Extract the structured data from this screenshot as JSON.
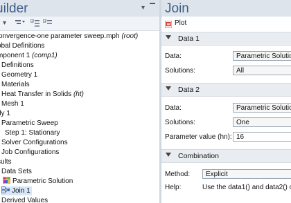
{
  "model_builder": {
    "title": "uilder",
    "tree": [
      {
        "label": "onvergence-one parameter sweep.mph",
        "tag": "(root)"
      },
      {
        "label": "obal Definitions",
        "tag": ""
      },
      {
        "label": "mponent 1",
        "tag": "(comp1)"
      },
      {
        "label": "Definitions",
        "tag": ""
      },
      {
        "label": "Geometry 1",
        "tag": ""
      },
      {
        "label": "Materials",
        "tag": ""
      },
      {
        "label": "Heat Transfer in Solids",
        "tag": "(ht)"
      },
      {
        "label": "Mesh 1",
        "tag": ""
      },
      {
        "label": "dy 1",
        "tag": ""
      },
      {
        "label": "Parametric Sweep",
        "tag": ""
      },
      {
        "label": "Step 1: Stationary",
        "tag": ""
      },
      {
        "label": "Solver Configurations",
        "tag": ""
      },
      {
        "label": "Job Configurations",
        "tag": ""
      },
      {
        "label": "sults",
        "tag": ""
      },
      {
        "label": "Data Sets",
        "tag": ""
      },
      {
        "label": "Parametric Solution",
        "tag": ""
      },
      {
        "label": "Join 1",
        "tag": ""
      },
      {
        "label": "Derived Values",
        "tag": ""
      }
    ]
  },
  "settings": {
    "title": "Join",
    "plot_label": "Plot",
    "data1": {
      "header": "Data 1",
      "data_label": "Data:",
      "data_value": "Parametric Solution",
      "solutions_label": "Solutions:",
      "solutions_value": "All"
    },
    "data2": {
      "header": "Data 2",
      "data_label": "Data:",
      "data_value": "Parametric Solution",
      "solutions_label": "Solutions:",
      "solutions_value": "One",
      "param_label": "Parameter value (hn):",
      "param_value": "16"
    },
    "combination": {
      "header": "Combination",
      "method_label": "Method:",
      "method_value": "Explicit",
      "help_label": "Help:",
      "help_text": "Use the data1() and data2() ope"
    }
  },
  "colors": {
    "header_bg": "#dde4ec",
    "title": "#3c5d87",
    "selection": "#d8e7f7",
    "section_bg": "#e9edf2"
  }
}
